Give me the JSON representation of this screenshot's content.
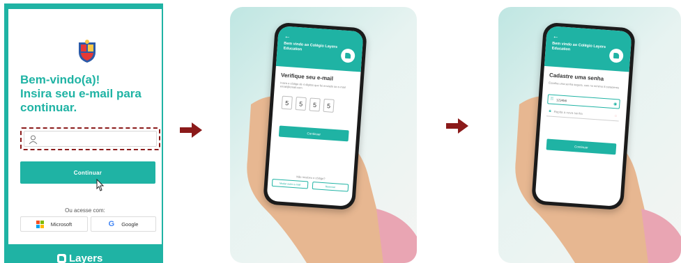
{
  "colors": {
    "brand": "#1fb3a4",
    "arrow": "#8b1a1a",
    "highlight_border": "#8b1a1a"
  },
  "login": {
    "crest_icon": "school-crest-icon",
    "welcome_lines": [
      "Bem-vindo(a)!",
      "Insira seu e-mail para",
      "continuar."
    ],
    "email_placeholder": "",
    "continue_label": "Continuar",
    "or_text": "Ou acesse com:",
    "microsoft_label": "Microsoft",
    "google_label": "Google",
    "brand_name": "Layers"
  },
  "verify_screen": {
    "back_icon": "←",
    "welcome": "Bem vindo ao Colégio Layers Education",
    "title": "Verifique seu e-mail",
    "subtitle": "Insira o código de 4 dígitos que foi enviado ao e-mail email@email.com",
    "code_digits": [
      "5",
      "5",
      "5",
      "5"
    ],
    "continue_label": "Continuar",
    "resend_question": "Não recebeu o código?",
    "change_email_label": "Mudar outro e-mail",
    "resend_label": "Reenviar"
  },
  "password_screen": {
    "back_icon": "←",
    "welcome": "Bem vindo ao Colégio Layers Education",
    "title": "Cadastre uma senha",
    "subtitle": "Escolha uma senha segura, com no mínimo 8 caracteres",
    "password_value": "123456",
    "confirm_placeholder": "Repita a nova senha",
    "continue_label": "Continuar"
  }
}
